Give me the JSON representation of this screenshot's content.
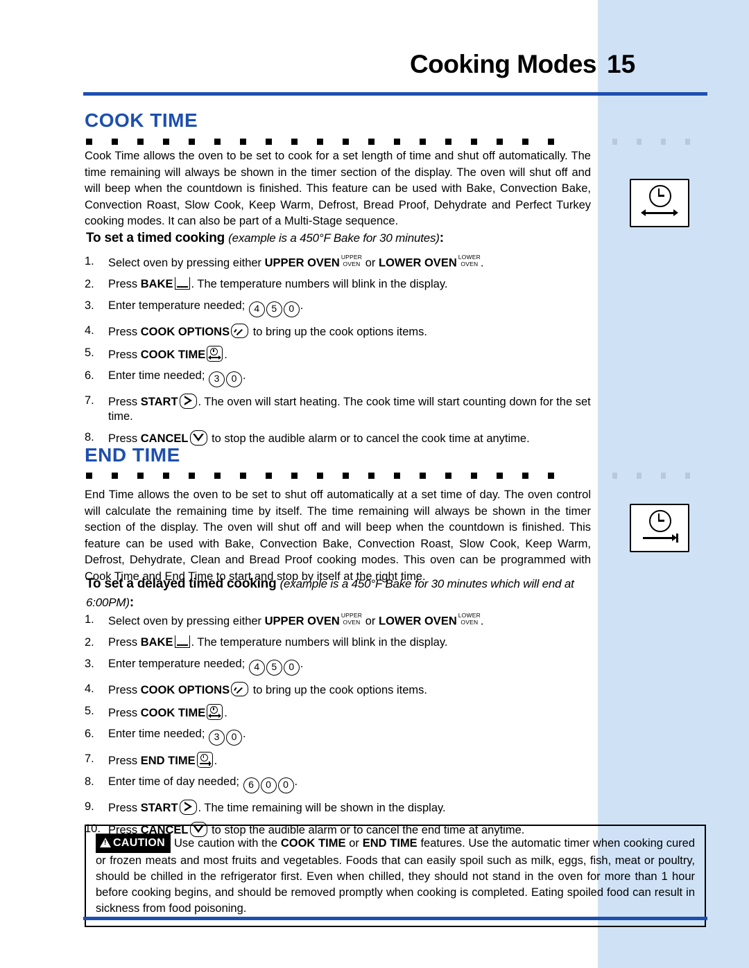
{
  "page": {
    "title": "Cooking Modes",
    "number": "15"
  },
  "sections": [
    {
      "heading": "COOK TIME",
      "body": "Cook Time allows the oven to be set to cook for a set length of time and shut off automatically. The time remaining will always be shown in the timer section of the display. The oven will shut off and will beep when the countdown is finished. This feature can be used with Bake, Convection Bake, Convection Roast, Slow Cook, Keep Warm, Defrost, Bread Proof, Dehydrate and Perfect Turkey cooking modes. It can also be part of a Multi-Stage sequence.",
      "subhead_bold": "To set a timed cooking ",
      "subhead_italic": "(example is a 450°F Bake for 30 minutes)",
      "subhead_colon": ":",
      "icon_name": "cook-time-icon"
    },
    {
      "heading": "END TIME",
      "body": "End Time allows the oven to be set to shut off automatically at a set time of day. The oven control will calculate the remaining time by itself. The time remaining will always be shown in the timer section of the display. The oven will shut off and will beep when the countdown is finished. This feature can be used with Bake, Convection Bake, Convection Roast, Slow Cook, Keep Warm, Defrost, Dehydrate, Clean and Bread Proof cooking modes. This oven can be programmed with Cook Time and End Time to start and stop by itself at the right time.",
      "subhead_bold": "To set a delayed timed cooking ",
      "subhead_italic": "(example is a 450°F Bake for 30 minutes which will end at 6:00PM)",
      "subhead_colon": ":",
      "icon_name": "end-time-icon"
    }
  ],
  "cook_time_steps": {
    "s1": {
      "num": "1.",
      "a": "Select oven by pressing either ",
      "b1": "UPPER OVEN",
      "sup1_l1": "UPPER",
      "sup1_l2": "OVEN",
      "mid": " or ",
      "b2": "LOWER OVEN",
      "sup2_l1": "LOWER",
      "sup2_l2": "OVEN",
      "end": "."
    },
    "s2": {
      "num": "2.",
      "a": "Press ",
      "b": "BAKE",
      "c": ". The temperature numbers will blink in the display."
    },
    "s3": {
      "num": "3.",
      "a": "Enter temperature needed; ",
      "d1": "4",
      "d2": "5",
      "d3": "0",
      "end": "."
    },
    "s4": {
      "num": "4.",
      "a": "Press ",
      "b": "COOK OPTIONS",
      "c": " to bring up the cook options items."
    },
    "s5": {
      "num": "5.",
      "a": "Press ",
      "b": "COOK TIME",
      "c": "."
    },
    "s6": {
      "num": "6.",
      "a": "Enter time needed; ",
      "d1": "3",
      "d2": "0",
      "end": "."
    },
    "s7": {
      "num": "7.",
      "a": "Press ",
      "b": "START",
      "c": ". The oven will start heating. The cook time will start counting down for the set time."
    },
    "s8": {
      "num": "8.",
      "a": "Press ",
      "b": "CANCEL",
      "c": " to stop the audible alarm or to cancel the cook time at anytime."
    }
  },
  "end_time_steps": {
    "s1": {
      "num": "1.",
      "a": "Select oven by pressing either ",
      "b1": "UPPER OVEN",
      "sup1_l1": "UPPER",
      "sup1_l2": "OVEN",
      "mid": " or ",
      "b2": "LOWER OVEN",
      "sup2_l1": "LOWER",
      "sup2_l2": "OVEN",
      "end": "."
    },
    "s2": {
      "num": "2.",
      "a": "Press ",
      "b": "BAKE",
      "c": ". The temperature numbers will blink in the display."
    },
    "s3": {
      "num": "3.",
      "a": "Enter temperature needed; ",
      "d1": "4",
      "d2": "5",
      "d3": "0",
      "end": "."
    },
    "s4": {
      "num": "4.",
      "a": "Press ",
      "b": "COOK OPTIONS",
      "c": " to bring up the cook options items."
    },
    "s5": {
      "num": "5.",
      "a": "Press ",
      "b": "COOK TIME",
      "c": "."
    },
    "s6": {
      "num": "6.",
      "a": "Enter time needed; ",
      "d1": "3",
      "d2": "0",
      "end": "."
    },
    "s7": {
      "num": "7.",
      "a": "Press ",
      "b": "END TIME",
      "c": "."
    },
    "s8": {
      "num": "8.",
      "a": "Enter time of day needed; ",
      "d1": "6",
      "d2": "0",
      "d3": "0",
      "end": "."
    },
    "s9": {
      "num": "9.",
      "a": "Press ",
      "b": "START",
      "c": ". The time remaining will be shown in the display."
    },
    "s10": {
      "num": "10.",
      "a": "Press ",
      "b": "CANCEL",
      "c": " to stop the audible alarm or to cancel the end time at anytime."
    }
  },
  "caution": {
    "tag": "CAUTION",
    "t1": "Use caution with the ",
    "b1": "COOK TIME",
    "t2": " or ",
    "b2": "END TIME",
    "t3": " features. Use the automatic timer when cooking cured or frozen meats and most fruits and vegetables. Foods that can easily spoil such as milk, eggs, fish, meat or poultry, should be chilled in the refrigerator first. Even when chilled, they should not stand in the oven for more than 1 hour before cooking begins, and should be removed promptly when cooking is completed. Eating spoiled food can result in sickness from food poisoning."
  },
  "colors": {
    "accent_blue": "#1d4fb0",
    "side_band": "#cfe2f5",
    "dot_light": "#b9c9dd"
  }
}
